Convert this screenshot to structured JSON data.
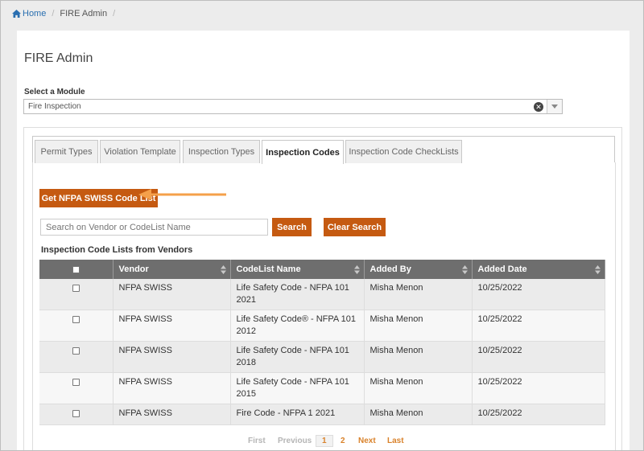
{
  "breadcrumb": {
    "home": "Home",
    "current": "FIRE Admin"
  },
  "page": {
    "title": "FIRE Admin"
  },
  "module": {
    "label": "Select a Module",
    "value": "Fire Inspection"
  },
  "tabs": [
    {
      "label": "Permit Types",
      "active": false
    },
    {
      "label": "Violation Template",
      "active": false
    },
    {
      "label": "Inspection Types",
      "active": false
    },
    {
      "label": "Inspection Codes",
      "active": true
    },
    {
      "label": "Inspection Code CheckLists",
      "active": false
    }
  ],
  "actions": {
    "get_list_label": "Get NFPA SWISS Code List",
    "search_button": "Search",
    "clear_button": "Clear Search"
  },
  "search": {
    "placeholder": "Search on Vendor or CodeList Name"
  },
  "list": {
    "title": "Inspection Code Lists from Vendors",
    "columns": [
      "Vendor",
      "CodeList Name",
      "Added By",
      "Added Date"
    ],
    "rows": [
      {
        "vendor": "NFPA SWISS",
        "name_line1": "Life Safety Code - NFPA 101",
        "name_line2": "2021",
        "added_by": "Misha Menon",
        "added_date": "10/25/2022"
      },
      {
        "vendor": "NFPA SWISS",
        "name_line1": "Life Safety Code® - NFPA 101",
        "name_line2": "2012",
        "added_by": "Misha Menon",
        "added_date": "10/25/2022"
      },
      {
        "vendor": "NFPA SWISS",
        "name_line1": "Life Safety Code - NFPA 101",
        "name_line2": "2018",
        "added_by": "Misha Menon",
        "added_date": "10/25/2022"
      },
      {
        "vendor": "NFPA SWISS",
        "name_line1": "Life Safety Code - NFPA 101",
        "name_line2": "2015",
        "added_by": "Misha Menon",
        "added_date": "10/25/2022"
      },
      {
        "vendor": "NFPA SWISS",
        "name_line1": "Fire Code - NFPA 1 2021",
        "name_line2": "",
        "added_by": "Misha Menon",
        "added_date": "10/25/2022"
      }
    ]
  },
  "pager": {
    "first": "First",
    "previous": "Previous",
    "current": "1",
    "page2": "2",
    "next": "Next",
    "last": "Last"
  },
  "colors": {
    "accent": "#c55a11",
    "header": "#6e6e6e",
    "link": "#d9822b"
  }
}
